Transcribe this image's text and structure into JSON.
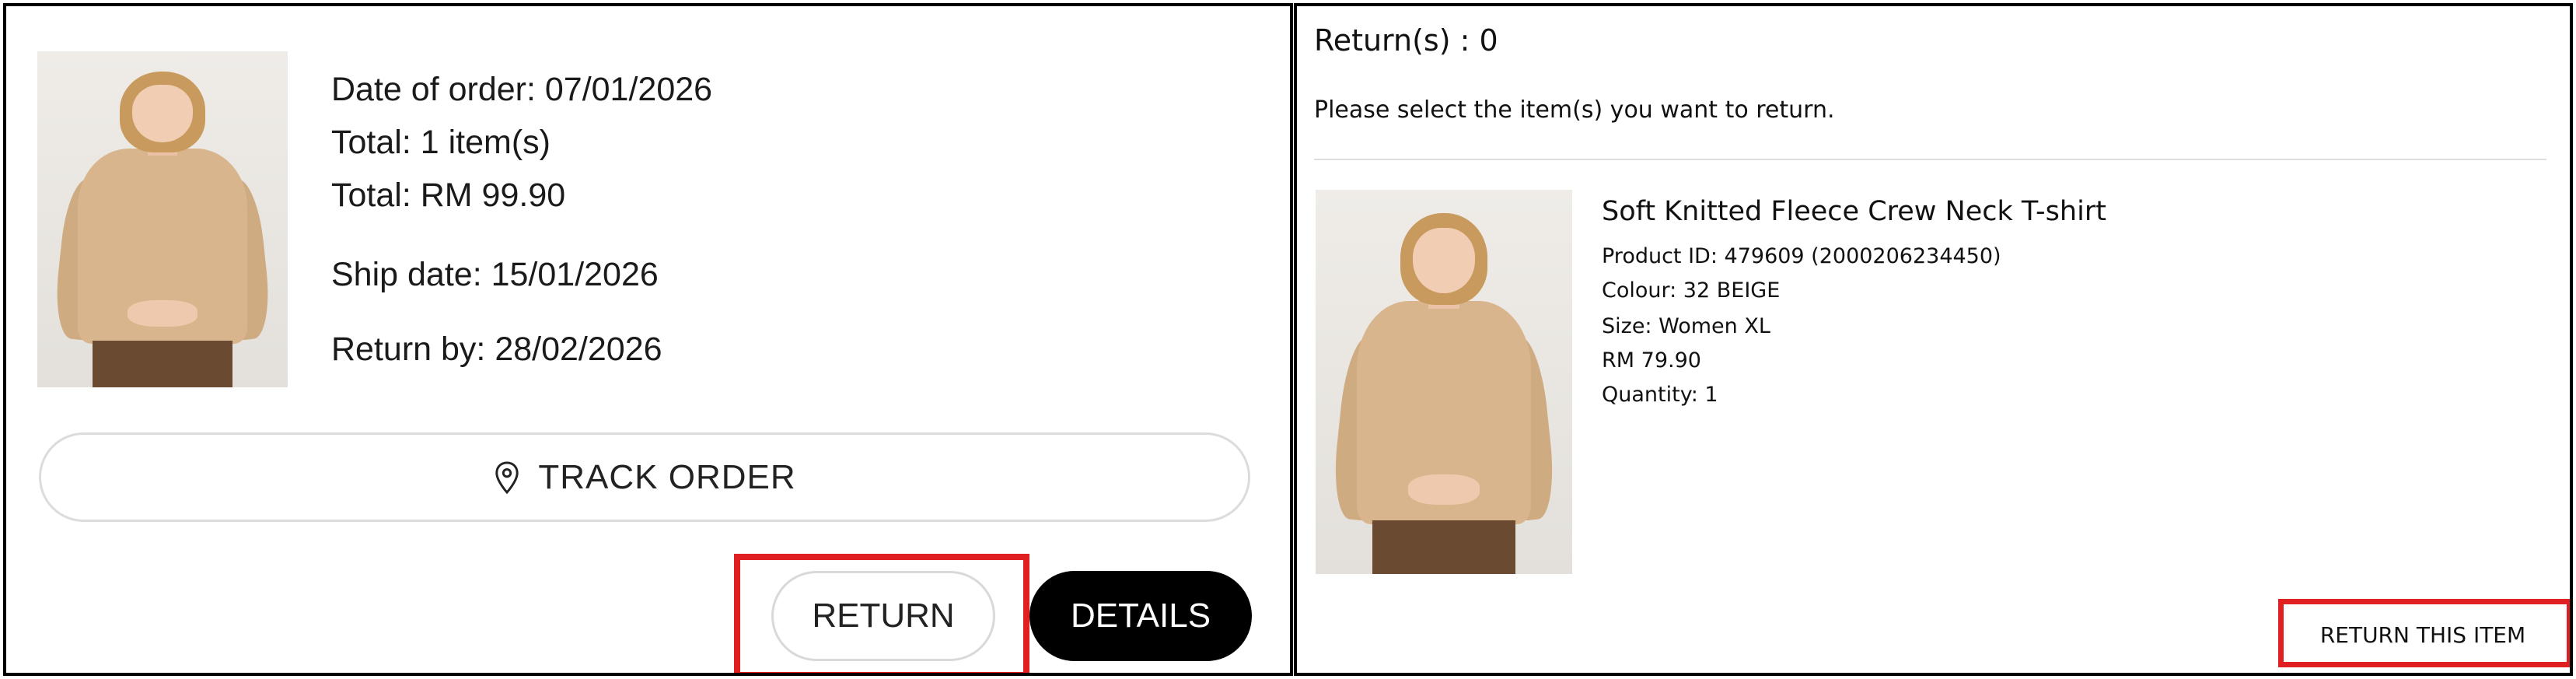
{
  "order_card": {
    "order_date": "Date of order: 07/01/2026",
    "total_items": "Total: 1 item(s)",
    "total_amount": "Total: RM 99.90",
    "ship_date": "Ship date: 15/01/2026",
    "return_by": "Return by: 28/02/2026",
    "track_order_label": "TRACK ORDER",
    "return_label": "RETURN",
    "details_label": "DETAILS",
    "track_icon": "location-pin-icon"
  },
  "return_panel": {
    "returns_count": "Return(s) : 0",
    "instruction": "Please select the item(s) you want to return.",
    "item": {
      "name": "Soft Knitted Fleece Crew Neck T-shirt",
      "product_id": "Product ID: 479609 (2000206234450)",
      "colour": "Colour: 32 BEIGE",
      "size": "Size: Women XL",
      "price": "RM 79.90",
      "quantity": "Quantity: 1"
    },
    "return_item_label": "RETURN THIS ITEM"
  },
  "colors": {
    "highlight": "#e02020",
    "details_button_bg": "#000000",
    "pill_border": "#dcdcdc"
  }
}
